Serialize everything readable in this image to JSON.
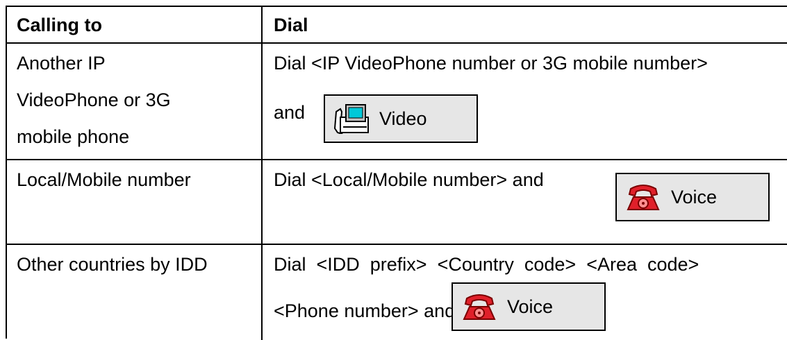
{
  "table": {
    "headers": {
      "col1": "Calling to",
      "col2": "Dial"
    },
    "rows": [
      {
        "calling_to_lines": [
          "Another IP",
          "VideoPhone or 3G",
          "mobile phone"
        ],
        "dial_line1": "Dial <IP VideoPhone number or 3G mobile number>",
        "dial_line2": "and",
        "button": {
          "label": "Video",
          "icon": "videophone-icon"
        }
      },
      {
        "calling_to": "Local/Mobile number",
        "dial_line1": "Dial <Local/Mobile number> and",
        "button": {
          "label": "Voice",
          "icon": "red-telephone-icon"
        }
      },
      {
        "calling_to": "Other countries by IDD",
        "dial_line1": "Dial  <IDD  prefix>  <Country  code>  <Area  code>",
        "dial_line2": "<Phone number> and",
        "button": {
          "label": "Voice",
          "icon": "red-telephone-icon"
        }
      }
    ]
  },
  "colors": {
    "button_bg": "#e6e6e6",
    "border": "#000000",
    "phone_red": "#e0202a"
  }
}
